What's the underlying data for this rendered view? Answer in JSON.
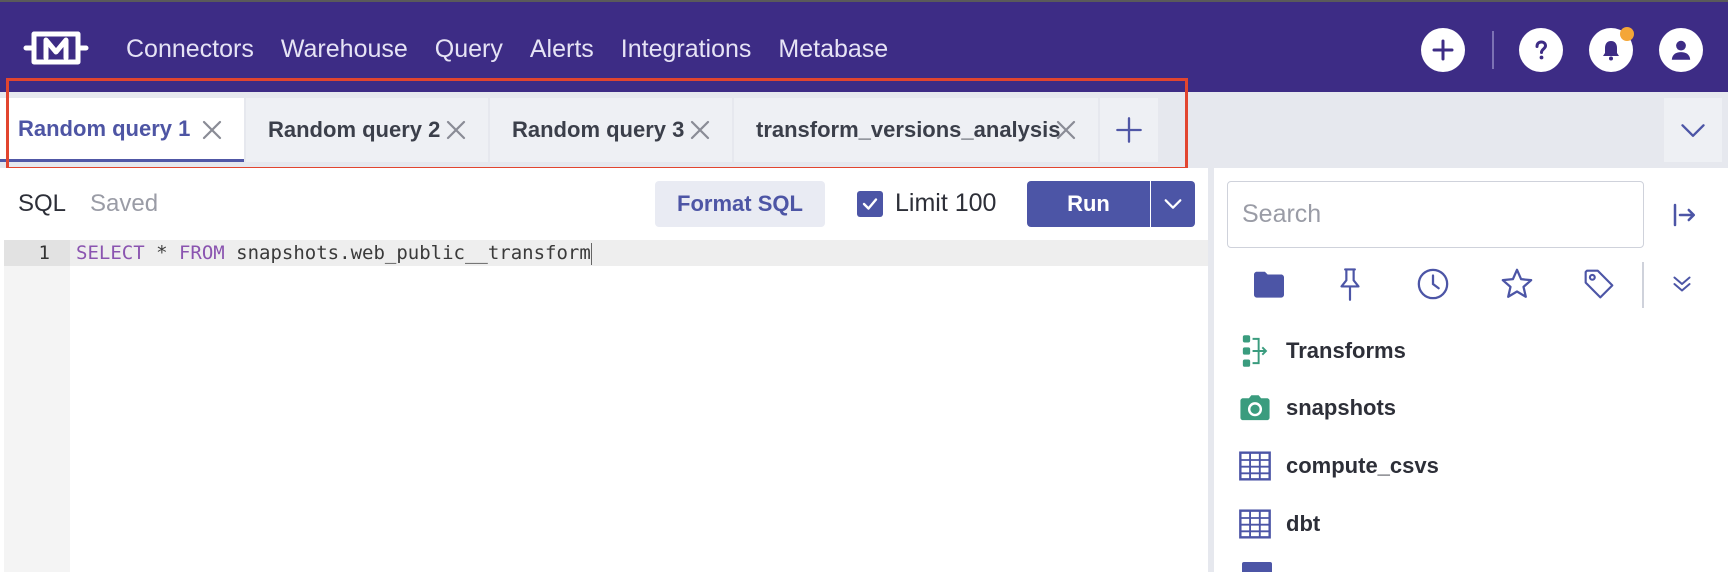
{
  "nav": {
    "items": [
      "Connectors",
      "Warehouse",
      "Query",
      "Alerts",
      "Integrations",
      "Metabase"
    ]
  },
  "tabs": [
    {
      "label": "Random query 1",
      "active": true
    },
    {
      "label": "Random query 2",
      "active": false
    },
    {
      "label": "Random query 3",
      "active": false
    },
    {
      "label": "transform_versions_analysis",
      "active": false
    }
  ],
  "editor": {
    "mode_label": "SQL",
    "status_label": "Saved",
    "format_label": "Format SQL",
    "limit_label": "Limit 100",
    "limit_checked": true,
    "run_label": "Run",
    "line_number": "1",
    "code_keyword1": "SELECT",
    "code_part1": " * ",
    "code_keyword2": "FROM",
    "code_part2": " snapshots.web_public__transform"
  },
  "sidebar": {
    "search_placeholder": "Search",
    "tree": [
      {
        "label": "Transforms",
        "icon": "transforms-icon"
      },
      {
        "label": "snapshots",
        "icon": "camera-icon"
      },
      {
        "label": "compute_csvs",
        "icon": "table-icon"
      },
      {
        "label": "dbt",
        "icon": "table-icon"
      }
    ]
  },
  "colors": {
    "topbar": "#3d2c85",
    "accent": "#4c55a6",
    "highlight": "#e2452f",
    "notification": "#f4a637",
    "tree_green": "#3a9c7e"
  }
}
